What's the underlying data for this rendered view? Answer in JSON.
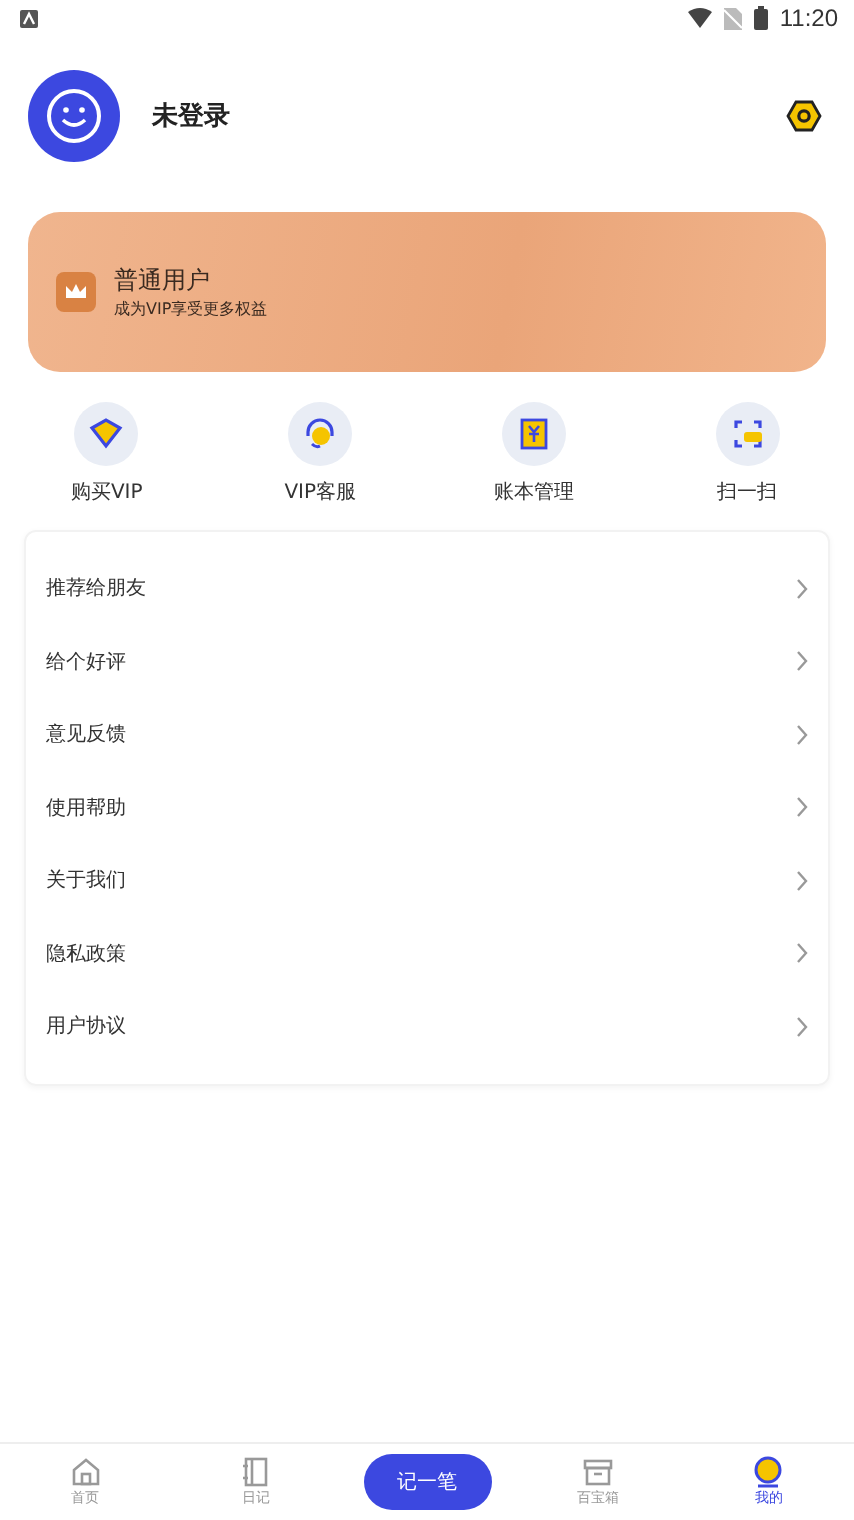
{
  "status_bar": {
    "time": "11:20"
  },
  "profile": {
    "name": "未登录"
  },
  "membership": {
    "title": "普通用户",
    "subtitle": "成为VIP享受更多权益"
  },
  "quick_actions": [
    {
      "kind": "vip",
      "label": "购买VIP"
    },
    {
      "kind": "service",
      "label": "VIP客服"
    },
    {
      "kind": "ledger",
      "label": "账本管理"
    },
    {
      "kind": "scan",
      "label": "扫一扫"
    }
  ],
  "menu": [
    {
      "label": "推荐给朋友"
    },
    {
      "label": "给个好评"
    },
    {
      "label": "意见反馈"
    },
    {
      "label": "使用帮助"
    },
    {
      "label": "关于我们"
    },
    {
      "label": "隐私政策"
    },
    {
      "label": "用户协议"
    }
  ],
  "bottom_nav": [
    {
      "kind": "home",
      "label": "首页",
      "selected": false
    },
    {
      "kind": "diary",
      "label": "日记",
      "selected": false
    },
    {
      "kind": "add",
      "label": "记一笔",
      "selected": false
    },
    {
      "kind": "box",
      "label": "百宝箱",
      "selected": false
    },
    {
      "kind": "me",
      "label": "我的",
      "selected": true
    }
  ]
}
